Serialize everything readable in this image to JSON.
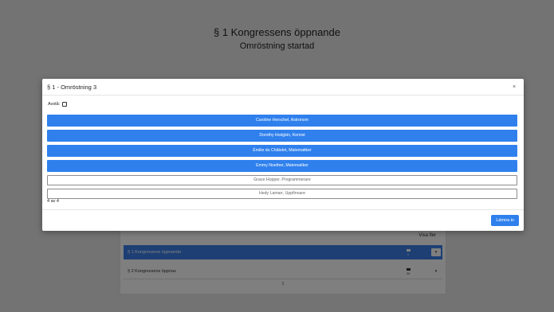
{
  "background": {
    "title": "§ 1 Kongressens öppnande",
    "subtitle": "Omröstning startad",
    "panel": {
      "visa_fler": "Visa fler",
      "rows": [
        {
          "label": "§ 1 Kongressens öppnande",
          "count": "1"
        },
        {
          "label": "§ 2 Kongressens öppnas",
          "count": "20"
        }
      ],
      "footer_count": "2"
    }
  },
  "modal": {
    "title": "§ 1 - Omröstning 3",
    "close_glyph": "×",
    "abstain_label": "Avstå:",
    "options": [
      {
        "label": "Caroline Herschel, Astronom",
        "selected": true
      },
      {
        "label": "Dorothy Hodgkin, Kemist",
        "selected": true
      },
      {
        "label": "Émilie du Châtelet, Matematiker",
        "selected": true
      },
      {
        "label": "Emmy Noether, Matematiker",
        "selected": true
      },
      {
        "label": "Grace Hopper, Programmerare",
        "selected": false
      },
      {
        "label": "Hedy Lamarr, Uppfinnare",
        "selected": false
      }
    ],
    "selection_count": "4 av 4",
    "submit_label": "Lämna in"
  },
  "colors": {
    "accent": "#2f80ed"
  }
}
